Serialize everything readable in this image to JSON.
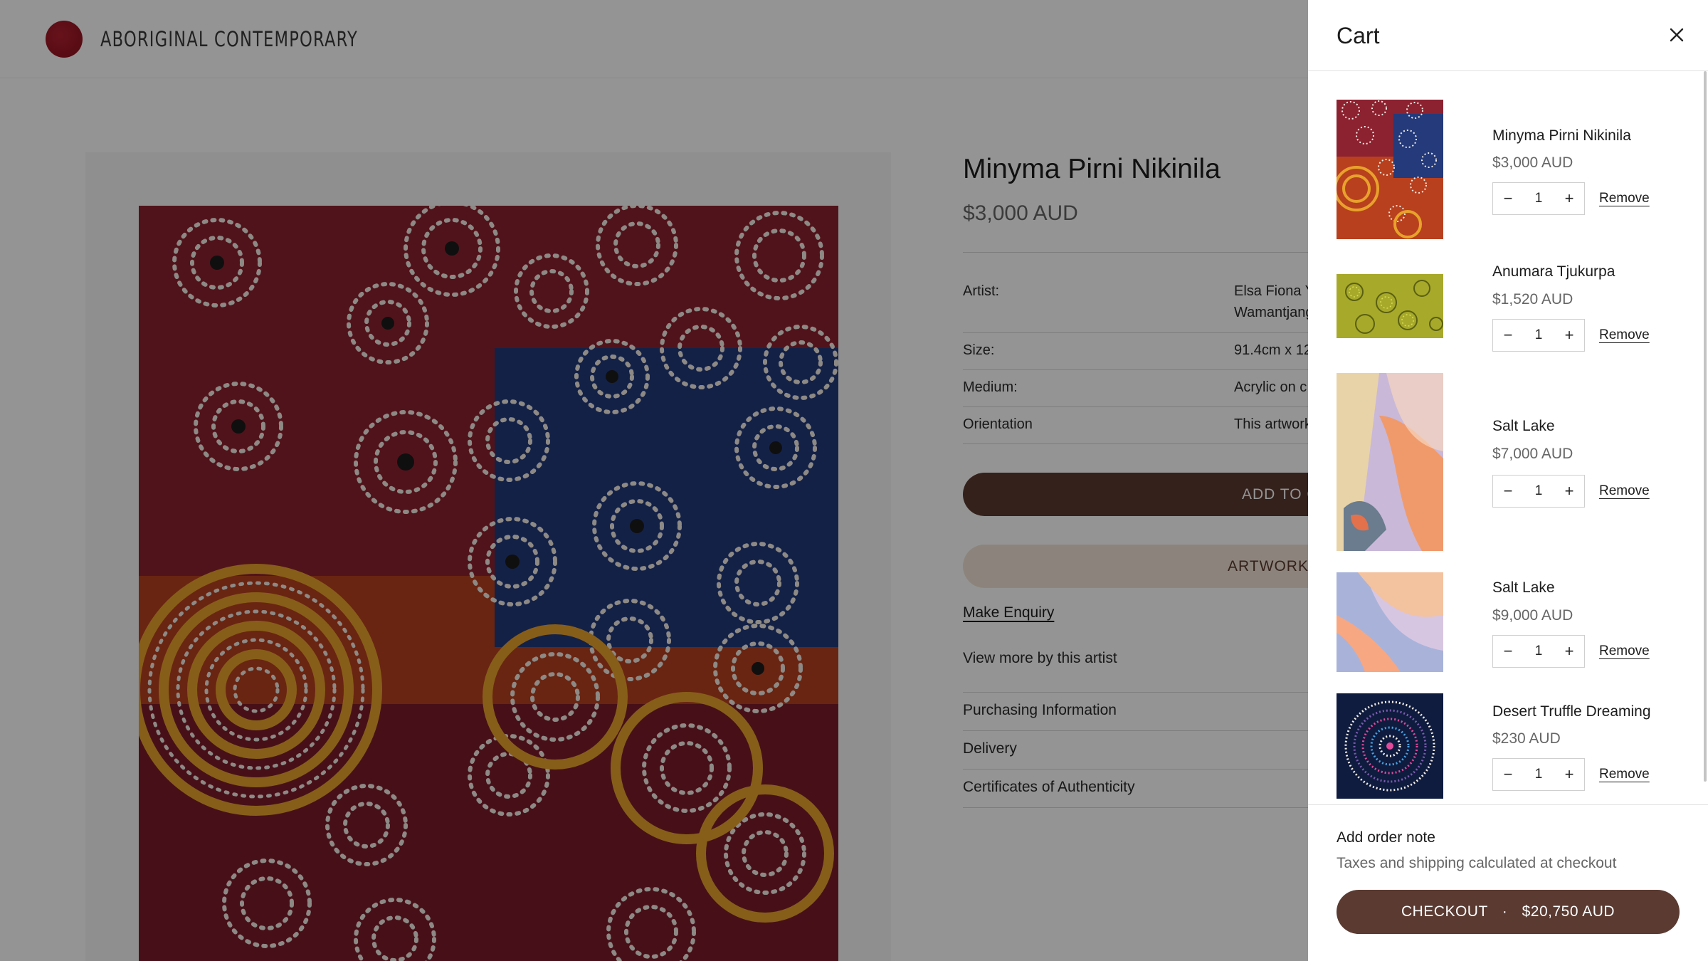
{
  "site": {
    "brand": "ABORIGINAL CONTEMPORARY"
  },
  "product": {
    "title": "Minyma Pirni Nikinila",
    "price": "$3,000 AUD",
    "specs": [
      {
        "label": "Artist:",
        "value_line1": "Elsa Fiona Y",
        "value_line2": "Wamantjang"
      },
      {
        "label": "Size:",
        "value_line1": "91.4cm x 12"
      },
      {
        "label": "Medium:",
        "value_line1": "Acrylic on c"
      },
      {
        "label": "Orientation",
        "value_line1": "This artwork"
      }
    ],
    "add_to_cart_label": "ADD TO C",
    "artwork_button_label": "ARTWORK",
    "enquiry_label": "Make Enquiry",
    "more_by_artist_label": "View more by this artist",
    "accordion": [
      "Purchasing Information",
      "Delivery",
      "Certificates of Authenticity"
    ]
  },
  "cart": {
    "title": "Cart",
    "items": [
      {
        "name": "Minyma Pirni Nikinila",
        "price": "$3,000 AUD",
        "quantity": "1",
        "remove_label": "Remove"
      },
      {
        "name": "Anumara Tjukurpa",
        "price": "$1,520 AUD",
        "quantity": "1",
        "remove_label": "Remove"
      },
      {
        "name": "Salt Lake",
        "price": "$7,000 AUD",
        "quantity": "1",
        "remove_label": "Remove"
      },
      {
        "name": "Salt Lake",
        "price": "$9,000 AUD",
        "quantity": "1",
        "remove_label": "Remove"
      },
      {
        "name": "Desert Truffle Dreaming",
        "price": "$230 AUD",
        "quantity": "1",
        "remove_label": "Remove"
      }
    ],
    "order_note_label": "Add order note",
    "tax_note": "Taxes and shipping calculated at checkout",
    "checkout_label": "CHECKOUT",
    "checkout_separator": "·",
    "total": "$20,750 AUD"
  },
  "colors": {
    "brand_red": "#a01828",
    "button_brown": "#5a3a31",
    "button_beige": "#f1e4d6",
    "overlay": "rgba(0,0,0,0.42)"
  },
  "icons": {
    "close": "close-icon",
    "minus": "minus-icon",
    "plus": "plus-icon"
  }
}
